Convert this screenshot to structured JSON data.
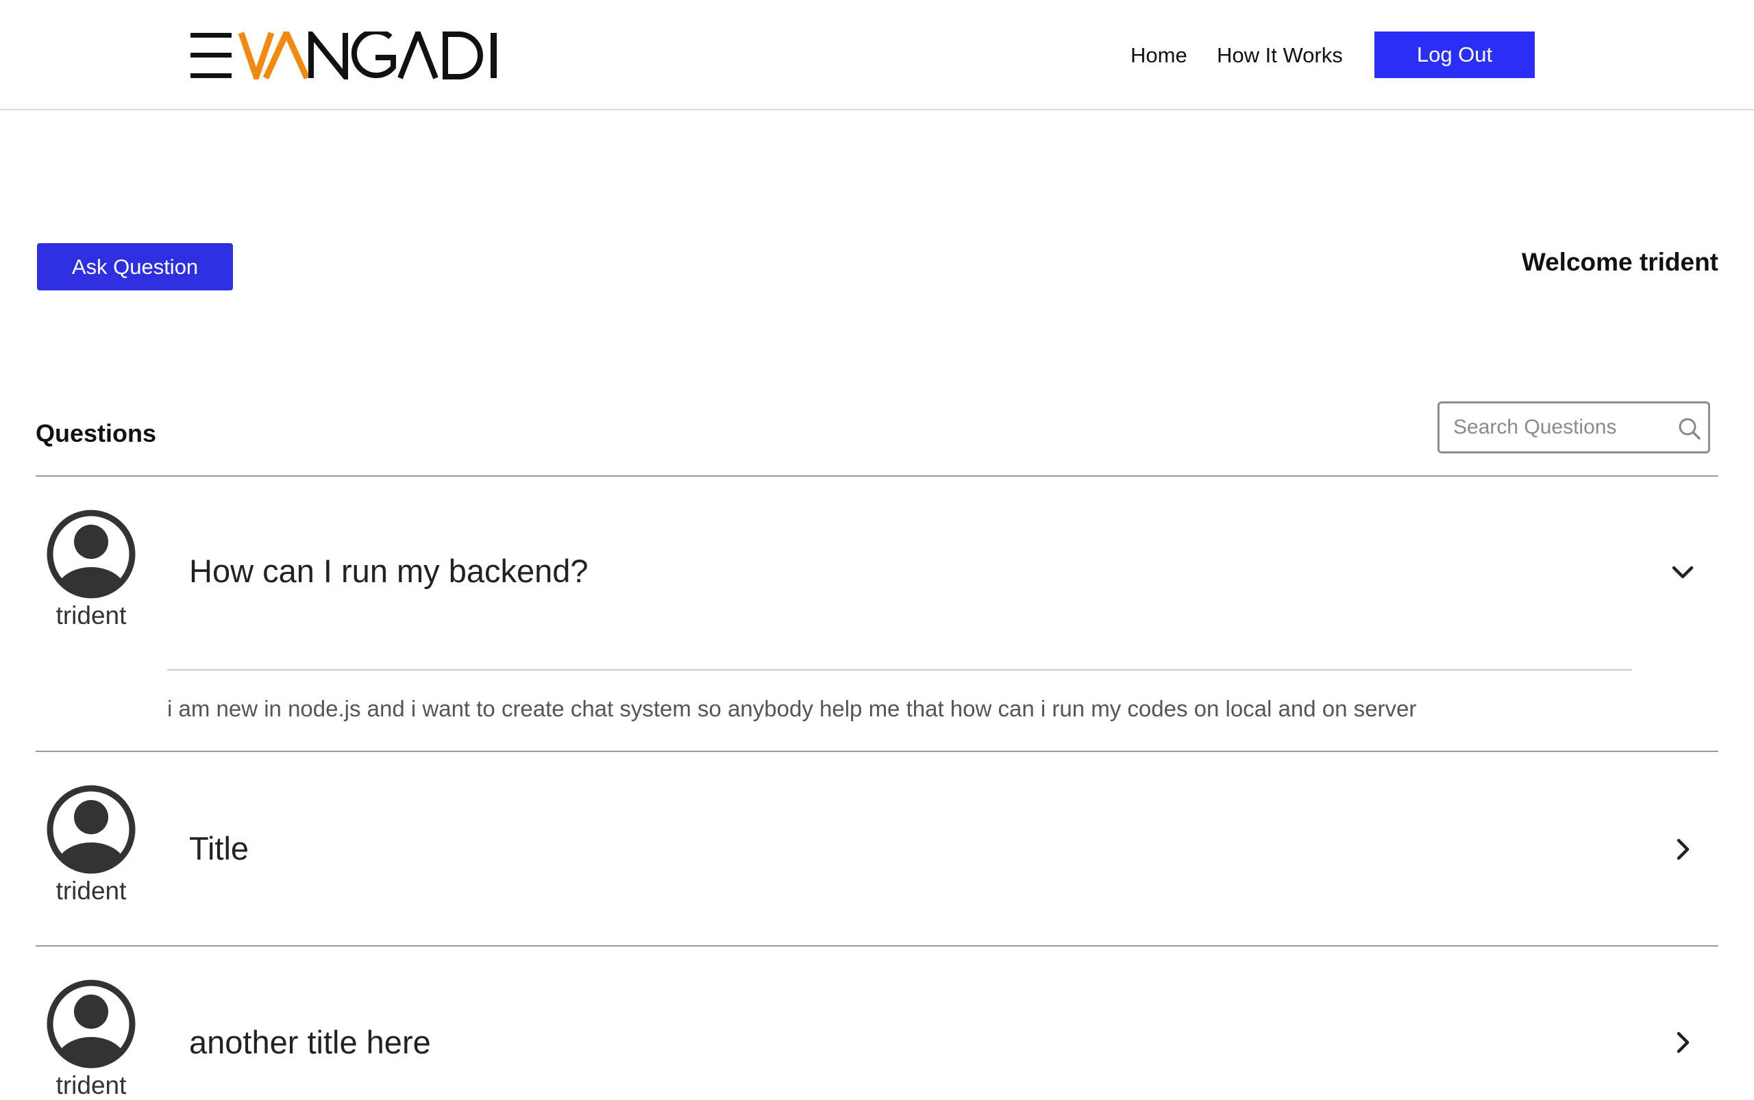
{
  "header": {
    "logo_text": "EVANGADI",
    "nav": [
      {
        "label": "Home"
      },
      {
        "label": "How It Works"
      }
    ],
    "logout_label": "Log Out"
  },
  "top": {
    "ask_button_label": "Ask Question",
    "welcome_text": "Welcome trident"
  },
  "questions": {
    "heading": "Questions",
    "search_placeholder": "Search Questions",
    "items": [
      {
        "username": "trident",
        "title": "How can I run my backend?",
        "expanded": true,
        "description": "i am new in node.js and i want to create chat system so anybody help me that how can i run my codes on local and on server"
      },
      {
        "username": "trident",
        "title": "Title",
        "expanded": false
      },
      {
        "username": "trident",
        "title": "another title here",
        "expanded": false
      }
    ]
  },
  "colors": {
    "brand_blue": "#2b2ef5",
    "ask_blue": "#2d2fe0",
    "logo_orange": "#f28a0f",
    "logo_dark": "#111111",
    "avatar_dark": "#333333"
  }
}
